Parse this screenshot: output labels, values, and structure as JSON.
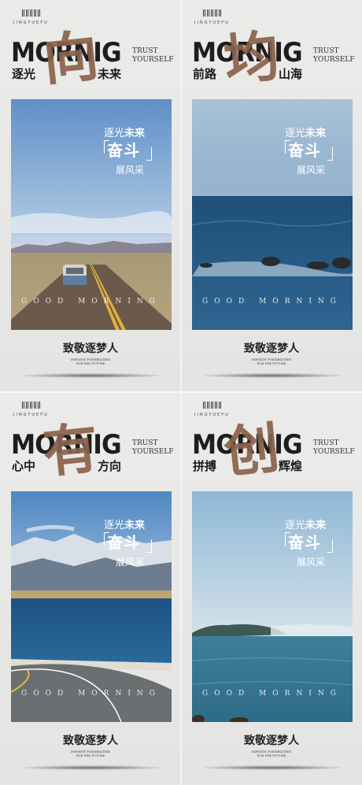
{
  "brand": "JINGYUEFU",
  "headline": "MORNIG",
  "tagline": [
    "TRUST",
    "YOURSELF"
  ],
  "slogan": {
    "line1_a": "逐光",
    "line1_b": "未来",
    "line2": "奋斗",
    "line3": "展风采"
  },
  "watermark": "GOOD MORNING",
  "tribute": "致敬逐梦人",
  "fineprint": [
    "INFINITE POSSIBILITIES",
    "FOR THE FUTURE"
  ],
  "posters": [
    {
      "sub_left": "逐光",
      "callig": "向",
      "sub_right": "未来",
      "scene": "road-desert"
    },
    {
      "sub_left": "前路",
      "callig": "均",
      "sub_right": "山海",
      "scene": "ocean-rocks"
    },
    {
      "sub_left": "心中",
      "callig": "有",
      "sub_right": "方向",
      "scene": "lake-mountain-road"
    },
    {
      "sub_left": "拼搏",
      "callig": "创",
      "sub_right": "辉煌",
      "scene": "sea-island"
    }
  ]
}
